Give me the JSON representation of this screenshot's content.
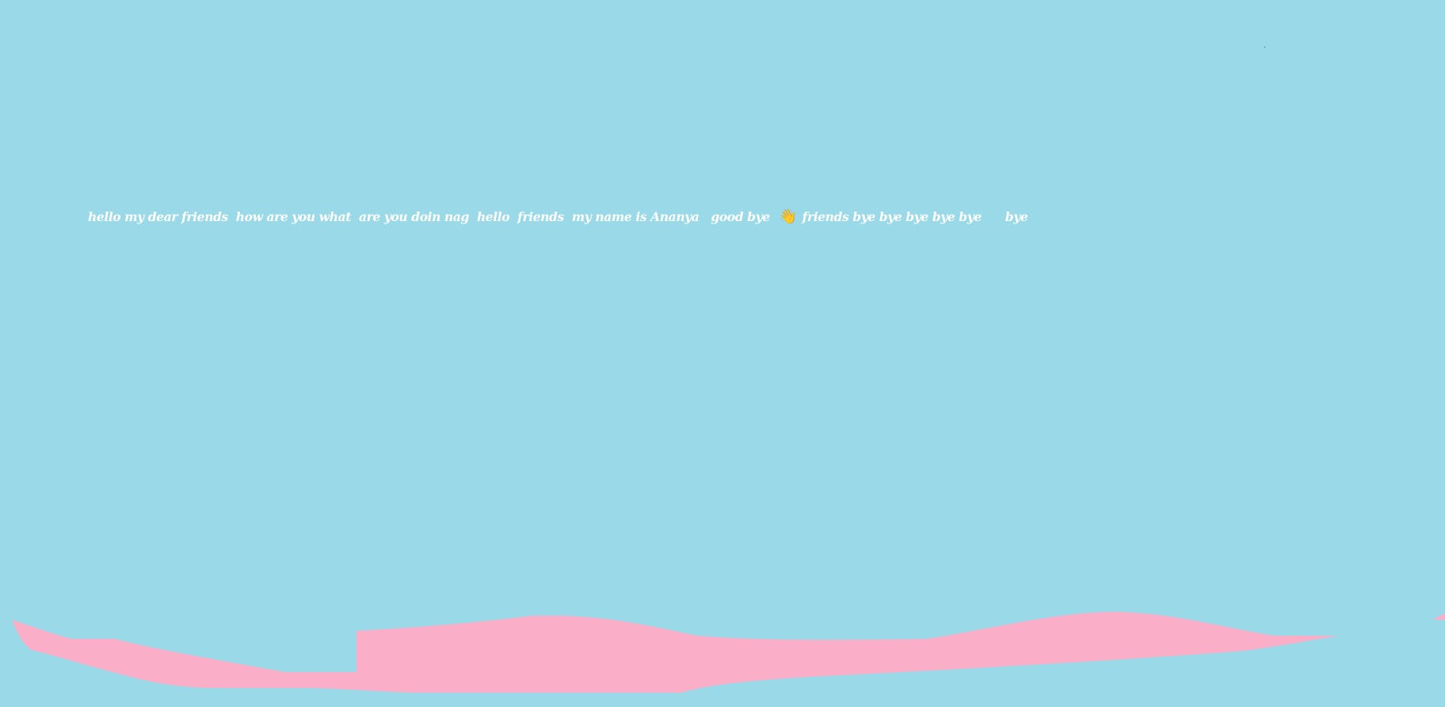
{
  "background_color": "#9ad9e8",
  "text_color": "#ffffff",
  "shape_color": "#fbaec8",
  "message": {
    "part1": "hello my dear friends  how are you what  are you doin nag  hello  friends  my name is Ananya   good bye  ",
    "emoji_name": "waving-hand-icon",
    "emoji": "👋",
    "part2": " friends bye bye bye bye bye      bye"
  }
}
